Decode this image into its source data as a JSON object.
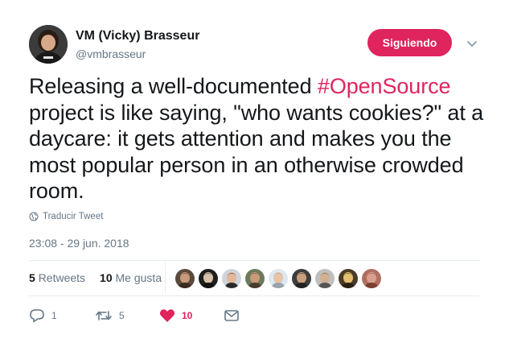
{
  "author": {
    "name": "VM (Vicky) Brasseur",
    "handle": "@vmbrasseur"
  },
  "follow_button": {
    "label": "Siguiendo"
  },
  "tweet": {
    "text_before": "Releasing a well-documented ",
    "hashtag": "#OpenSource",
    "text_after": " project is like saying, \"who wants cookies?\" at a daycare: it gets attention and makes you the most popular person in an otherwise crowded room."
  },
  "translate": {
    "label": "Traducir Tweet"
  },
  "timestamp": "23:08 - 29 jun. 2018",
  "stats": {
    "retweets_count": "5",
    "retweets_label": "Retweets",
    "likes_count": "10",
    "likes_label": "Me gusta"
  },
  "likers": [
    {
      "bg": "#5a4a3e",
      "skin": "#c89a7a",
      "hair": "#3a2a20"
    },
    {
      "bg": "#1e1e1e",
      "skin": "#d8c0a8",
      "hair": "#111111"
    },
    {
      "bg": "#cfd4da",
      "skin": "#e2b89a",
      "hair": "#2a2a2a"
    },
    {
      "bg": "#6b7a5a",
      "skin": "#c99a78",
      "hair": "#4a3a2a"
    },
    {
      "bg": "#dfe8ef",
      "skin": "#e8c4a8",
      "hair": "#9aa3ab"
    },
    {
      "bg": "#3d3d3d",
      "skin": "#c8a080",
      "hair": "#222222"
    },
    {
      "bg": "#bfbfbf",
      "skin": "#d0b090",
      "hair": "#555555"
    },
    {
      "bg": "#4a3b28",
      "skin": "#e3c070",
      "hair": "#2b2010"
    },
    {
      "bg": "#b07060",
      "skin": "#d9a090",
      "hair": "#7a4030"
    }
  ],
  "actions": {
    "reply_count": "1",
    "retweet_count": "5",
    "like_count": "10"
  },
  "colors": {
    "accent": "#e0245e",
    "muted": "#657786",
    "divider": "#e6ecf0"
  }
}
